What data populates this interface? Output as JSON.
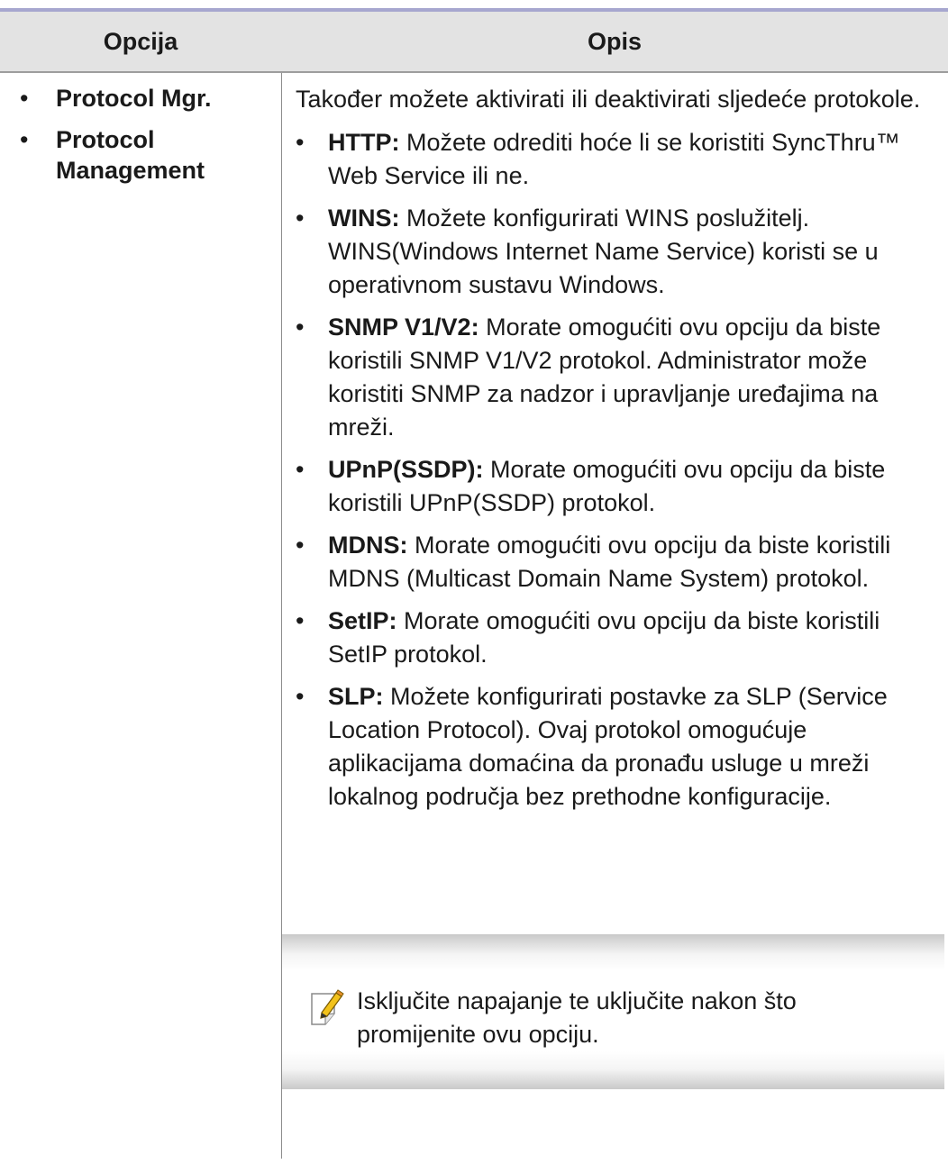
{
  "header": {
    "col_option": "Opcija",
    "col_description": "Opis"
  },
  "options": [
    "Protocol Mgr.",
    "Protocol Management"
  ],
  "description": {
    "intro": "Također možete aktivirati ili deaktivirati sljedeće protokole.",
    "items": [
      {
        "term": "HTTP:",
        "text": " Možete odrediti hoće li se koristiti SyncThru™ Web Service ili ne."
      },
      {
        "term": "WINS:",
        "text": " Možete konfigurirati WINS poslužitelj. WINS(Windows Internet Name Service) koristi se u operativnom sustavu Windows."
      },
      {
        "term": "SNMP V1/V2:",
        "text": " Morate omogućiti ovu opciju da biste koristili SNMP V1/V2 protokol. Administrator može koristiti SNMP za nadzor i upravljanje uređajima na mreži."
      },
      {
        "term": "UPnP(SSDP):",
        "text": " Morate omogućiti ovu opciju da biste koristili UPnP(SSDP) protokol."
      },
      {
        "term": "MDNS:",
        "text": " Morate omogućiti ovu opciju da biste koristili MDNS (Multicast Domain Name System) protokol."
      },
      {
        "term": "SetIP:",
        "text": " Morate omogućiti ovu opciju da biste koristili SetIP protokol."
      },
      {
        "term": "SLP:",
        "text": " Možete konfigurirati postavke za SLP (Service Location Protocol). Ovaj protokol omogućuje aplikacijama domaćina da pronađu usluge u mreži lokalnog područja bez prethodne konfiguracije."
      }
    ]
  },
  "note": {
    "icon": "note-pencil-icon",
    "text": "Isključite napajanje te uključite nakon što promijenite ovu opciju."
  },
  "bullet": "•",
  "colors": {
    "header_bg": "#e3e3e3",
    "top_rule": "#a7a7cf",
    "icon_yellow": "#f2c21a"
  }
}
